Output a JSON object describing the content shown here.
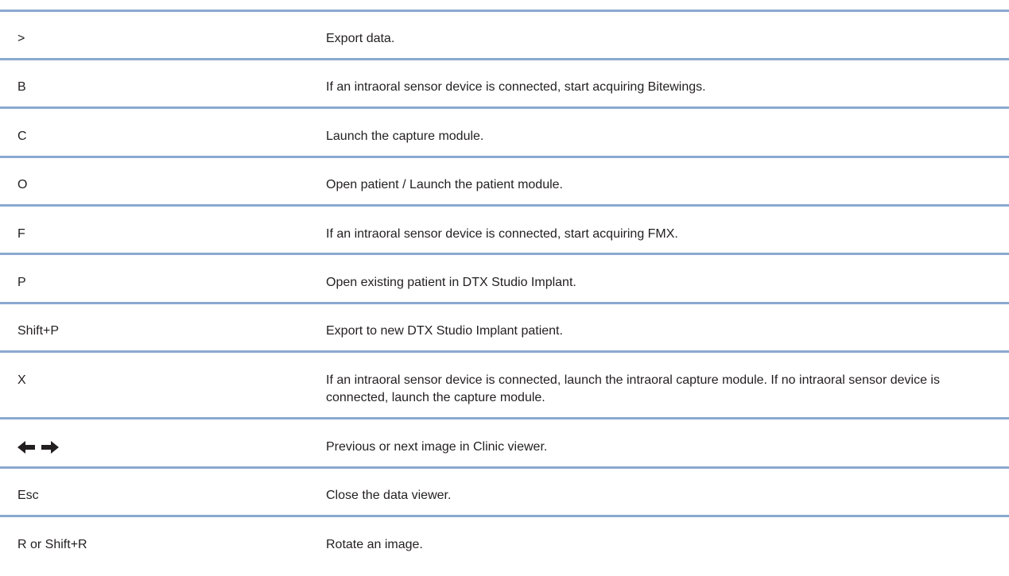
{
  "rows": [
    {
      "key": ">",
      "description": "Export data."
    },
    {
      "key": "B",
      "description": "If an intraoral sensor device is connected, start acquiring Bitewings."
    },
    {
      "key": "C",
      "description": "Launch the capture module."
    },
    {
      "key": "O",
      "description": "Open patient / Launch the patient module."
    },
    {
      "key": "F",
      "description": "If an intraoral sensor device is connected, start acquiring FMX."
    },
    {
      "key": "P",
      "description": "Open existing patient in DTX Studio Implant."
    },
    {
      "key": "Shift+P",
      "description": "Export to new DTX Studio Implant patient."
    },
    {
      "key": "X",
      "description": "If an intraoral sensor device is connected, launch the intraoral capture module. If no intraoral sensor device is connected, launch the capture module."
    },
    {
      "key_icons": [
        "left-arrow-icon",
        "right-arrow-icon"
      ],
      "description": "Previous or next image in Clinic viewer."
    },
    {
      "key": "Esc",
      "description": "Close the data viewer."
    },
    {
      "key": "R or Shift+R",
      "description": "Rotate an image."
    }
  ],
  "colors": {
    "divider": "#8aa9d0",
    "text": "#231f20"
  }
}
